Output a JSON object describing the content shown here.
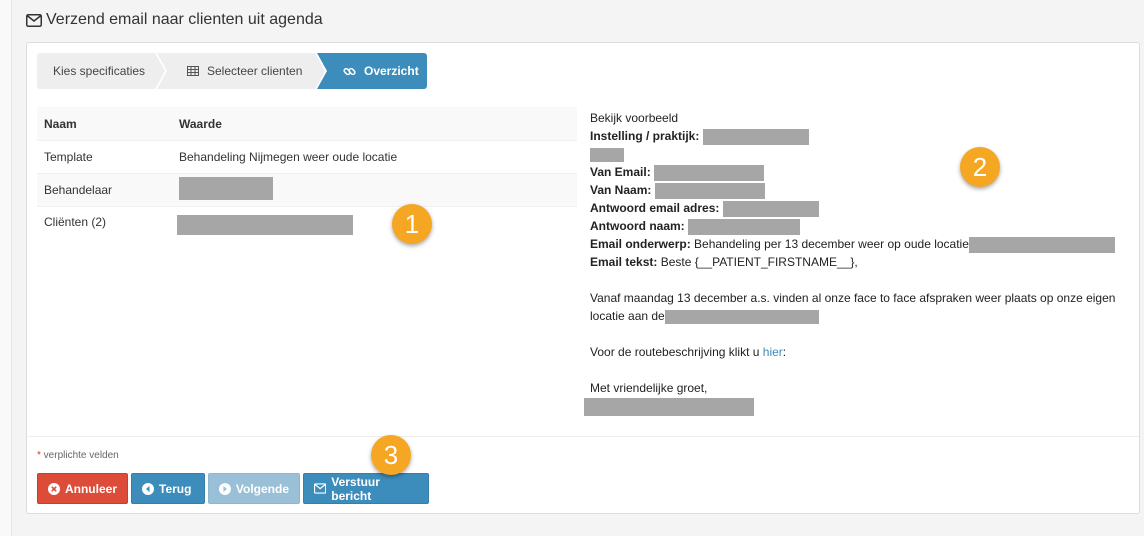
{
  "header": {
    "title": "Verzend email naar clienten uit agenda"
  },
  "wizard": {
    "step1": "Kies specificaties",
    "step2": "Selecteer clienten",
    "step3": "Overzicht"
  },
  "table": {
    "head_name": "Naam",
    "head_value": "Waarde",
    "rows": [
      {
        "name": "Template",
        "value": "Behandeling Nijmegen weer oude locatie"
      },
      {
        "name": "Behandelaar",
        "value": ""
      },
      {
        "name": "Cliënten (2)",
        "value": ""
      }
    ]
  },
  "preview": {
    "title": "Bekijk voorbeeld",
    "institution_label": "Instelling / praktijk:",
    "from_email_label": "Van Email:",
    "from_name_label": "Van Naam:",
    "reply_email_label": "Antwoord email adres:",
    "reply_name_label": "Antwoord naam:",
    "subject_label": "Email onderwerp:",
    "subject_value": "Behandeling per 13 december weer op oude locatie",
    "body_label": "Email tekst:",
    "body_greeting": "Beste {__PATIENT_FIRSTNAME__},",
    "body_para1_a": "Vanaf maandag 13 december a.s. vinden al onze face to face afspraken weer plaats op onze eigen",
    "body_para1_b": "locatie aan de",
    "body_para2_a": "Voor de routebeschrijving klikt u ",
    "body_para2_link": "hier",
    "body_para2_b": ":",
    "body_closing": "Met vriendelijke groet,"
  },
  "footer": {
    "required_star": "*",
    "required_text": " verplichte velden",
    "btn_cancel": "Annuleer",
    "btn_back": "Terug",
    "btn_next": "Volgende",
    "btn_send": "Verstuur bericht"
  },
  "badges": {
    "b1": "1",
    "b2": "2",
    "b3": "3"
  },
  "colors": {
    "primary": "#3c8dbc",
    "danger": "#dd4b39",
    "badge": "#f5a623",
    "redaction": "#a6a6a6"
  }
}
